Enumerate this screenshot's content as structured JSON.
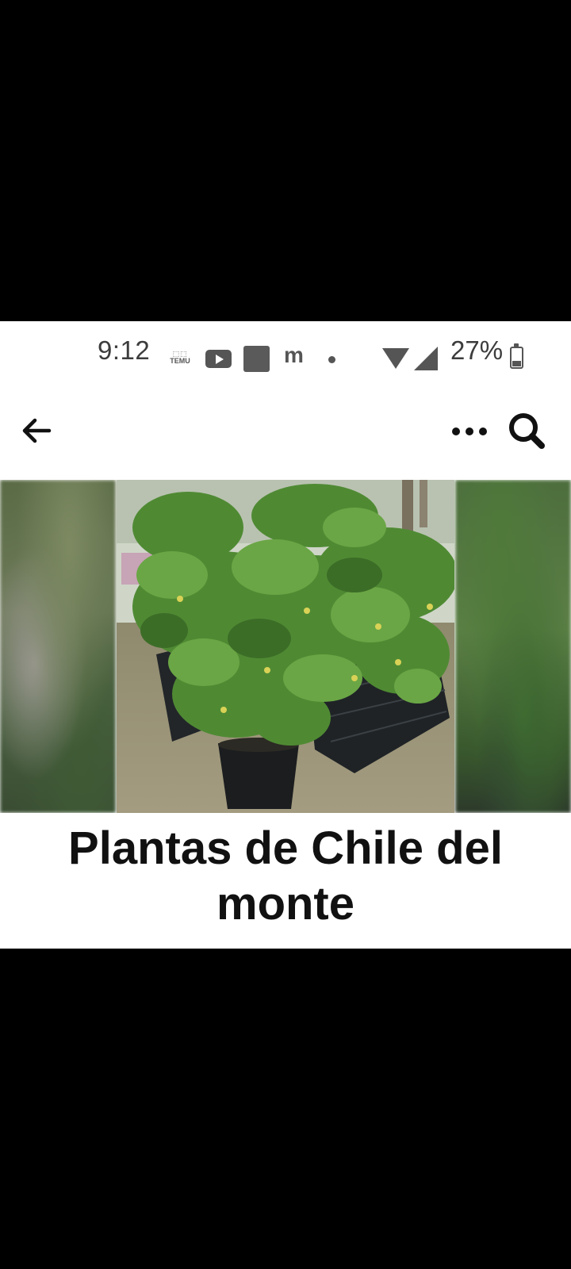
{
  "status_bar": {
    "time": "9:12",
    "notification_icons": [
      "temu-icon",
      "youtube-icon",
      "app-icon",
      "m-app-icon",
      "dot-icon"
    ],
    "temu_label": "TEMU",
    "battery": "27%"
  },
  "app_bar": {
    "back_icon": "arrow-left-icon",
    "more_icon": "more-horizontal-icon",
    "search_icon": "search-icon"
  },
  "listing": {
    "title": "Plantas de Chile del monte"
  },
  "colors": {
    "background": "#000000",
    "screen": "#ffffff",
    "status_text": "#3c3c3c",
    "title_text": "#111111"
  }
}
